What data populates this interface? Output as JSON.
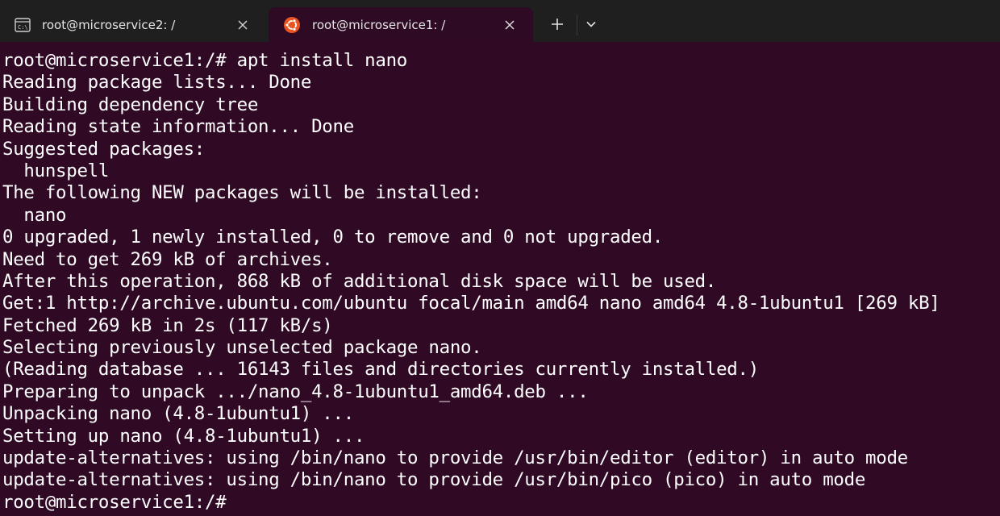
{
  "tabs": [
    {
      "label": "root@microservice2: /",
      "icon": "cmd-icon",
      "active": false
    },
    {
      "label": "root@microservice1: /",
      "icon": "ubuntu-icon",
      "active": true
    }
  ],
  "colors": {
    "terminal_bg": "#300a24",
    "tabbar_bg": "#1f1f1f",
    "active_tab_bg": "#2f0a25",
    "ubuntu_orange": "#e95420",
    "text": "#ffffff"
  },
  "terminal": {
    "lines": [
      "root@microservice1:/# apt install nano",
      "Reading package lists... Done",
      "Building dependency tree",
      "Reading state information... Done",
      "Suggested packages:",
      "  hunspell",
      "The following NEW packages will be installed:",
      "  nano",
      "0 upgraded, 1 newly installed, 0 to remove and 0 not upgraded.",
      "Need to get 269 kB of archives.",
      "After this operation, 868 kB of additional disk space will be used.",
      "Get:1 http://archive.ubuntu.com/ubuntu focal/main amd64 nano amd64 4.8-1ubuntu1 [269 kB]",
      "Fetched 269 kB in 2s (117 kB/s)",
      "Selecting previously unselected package nano.",
      "(Reading database ... 16143 files and directories currently installed.)",
      "Preparing to unpack .../nano_4.8-1ubuntu1_amd64.deb ...",
      "Unpacking nano (4.8-1ubuntu1) ...",
      "Setting up nano (4.8-1ubuntu1) ...",
      "update-alternatives: using /bin/nano to provide /usr/bin/editor (editor) in auto mode",
      "update-alternatives: using /bin/nano to provide /usr/bin/pico (pico) in auto mode"
    ],
    "prompt": "root@microservice1:/#"
  }
}
